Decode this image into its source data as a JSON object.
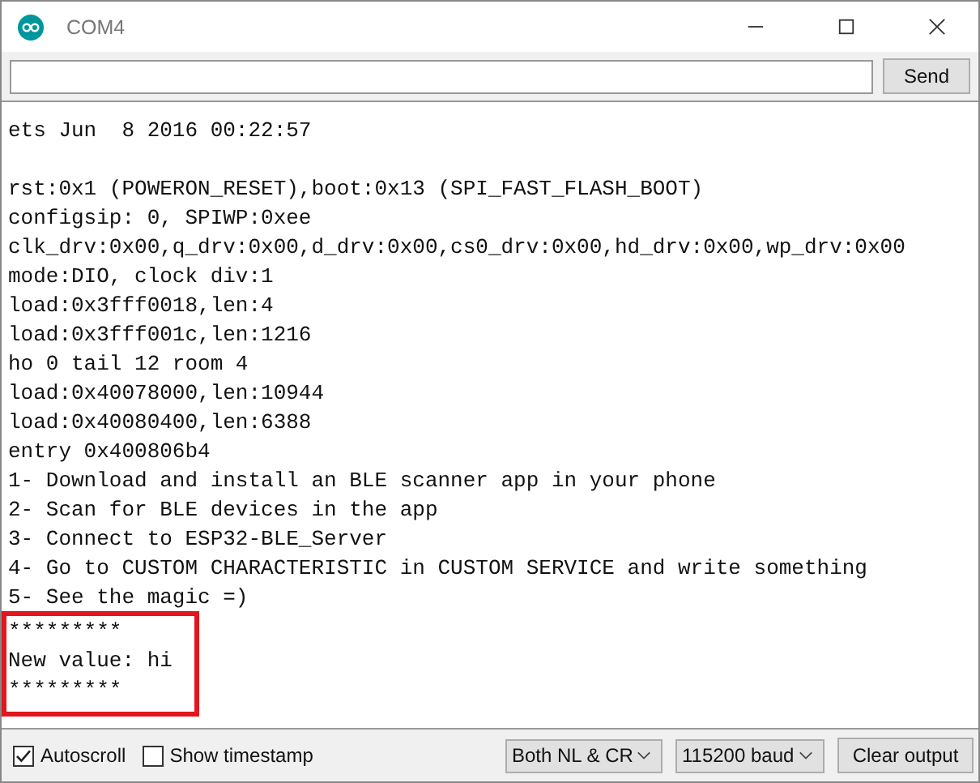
{
  "window": {
    "title": "COM4"
  },
  "send_bar": {
    "button": "Send"
  },
  "output": {
    "header_lines": [
      "ets Jun  8 2016 00:22:57"
    ],
    "lines": [
      "rst:0x1 (POWERON_RESET),boot:0x13 (SPI_FAST_FLASH_BOOT)",
      "configsip: 0, SPIWP:0xee",
      "clk_drv:0x00,q_drv:0x00,d_drv:0x00,cs0_drv:0x00,hd_drv:0x00,wp_drv:0x00",
      "mode:DIO, clock div:1",
      "load:0x3fff0018,len:4",
      "load:0x3fff001c,len:1216",
      "ho 0 tail 12 room 4",
      "load:0x40078000,len:10944",
      "load:0x40080400,len:6388",
      "entry 0x400806b4",
      "1- Download and install an BLE scanner app in your phone",
      "2- Scan for BLE devices in the app",
      "3- Connect to ESP32-BLE_Server",
      "4- Go to CUSTOM CHARACTERISTIC in CUSTOM SERVICE and write something",
      "5- See the magic =)"
    ],
    "highlighted_lines": [
      "*********",
      "New value: hi",
      "*********"
    ]
  },
  "footer": {
    "autoscroll": {
      "label": "Autoscroll",
      "checked": true
    },
    "timestamp": {
      "label": "Show timestamp",
      "checked": false
    },
    "line_ending": "Both NL & CR",
    "baud": "115200 baud",
    "clear_button": "Clear output"
  }
}
